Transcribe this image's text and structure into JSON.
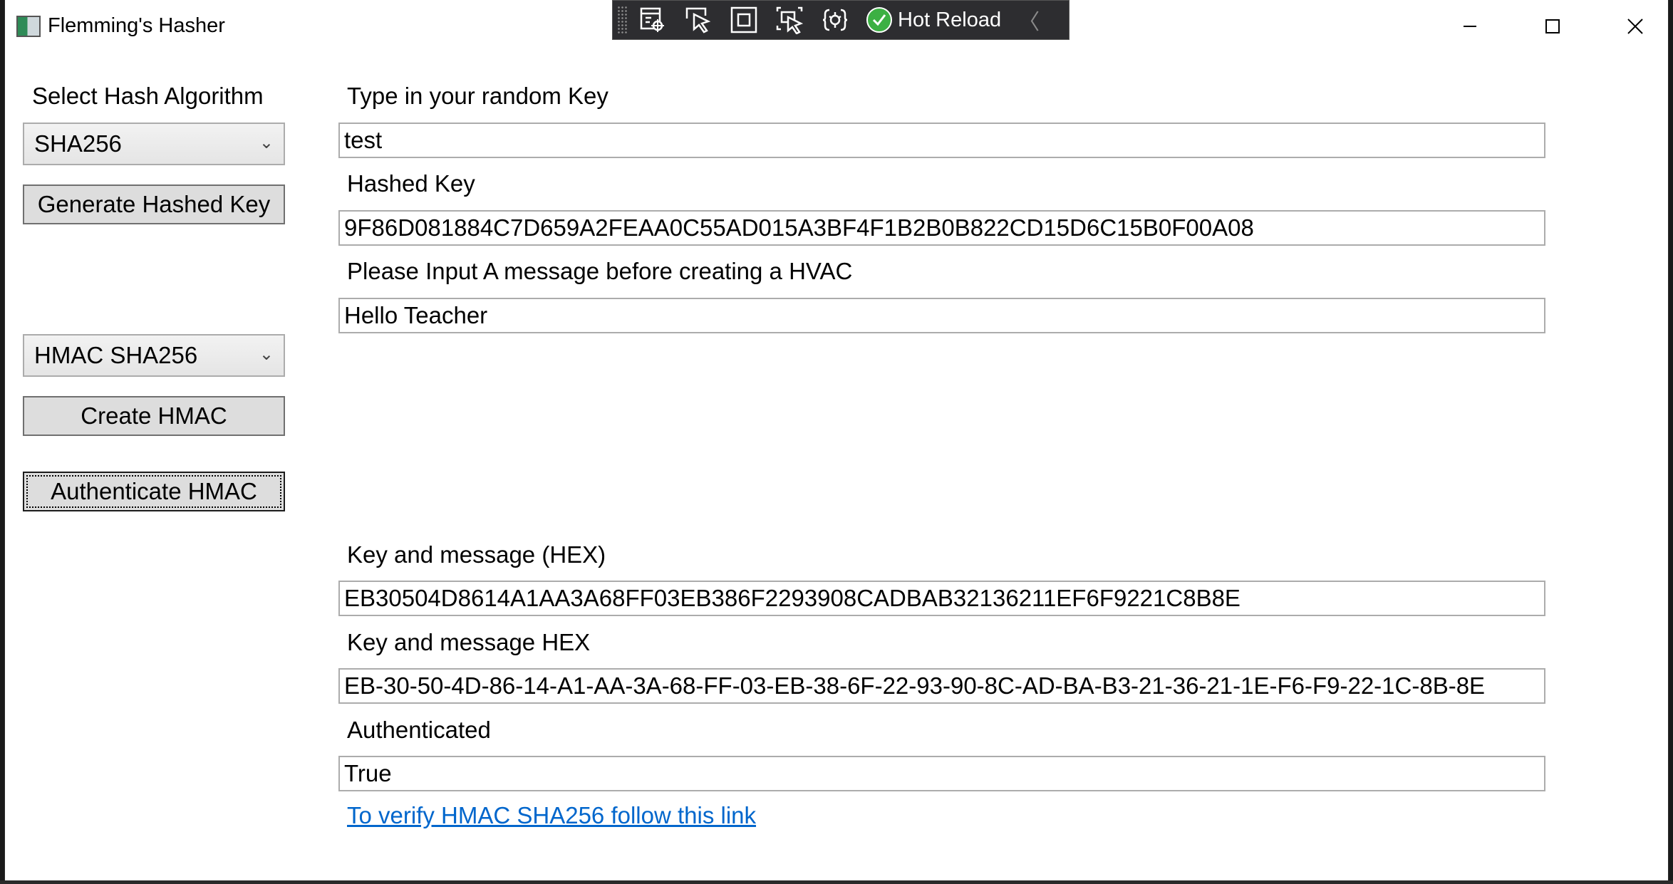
{
  "window": {
    "title": "Flemming's Hasher",
    "minimize_glyph": "—",
    "maximize_glyph": "☐",
    "close_glyph": "✕"
  },
  "devbar": {
    "tools": [
      "live-visual-tree-icon",
      "select-element-icon",
      "display-layout-adorners-icon",
      "track-focus-icon",
      "xaml-binding-icon"
    ],
    "hot_reload_label": "Hot Reload",
    "collapse_glyph": "〈"
  },
  "left": {
    "algorithm_label": "Select Hash Algorithm",
    "algorithm_selected": "SHA256",
    "generate_button": "Generate Hashed Key",
    "hmac_selected": "HMAC SHA256",
    "create_hmac_button": "Create  HMAC",
    "authenticate_button": "Authenticate  HMAC"
  },
  "main": {
    "key_label": "Type in your random Key",
    "key_value": "test",
    "hashed_label": "Hashed Key",
    "hashed_value": "9F86D081884C7D659A2FEAA0C55AD015A3BF4F1B2B0B822CD15D6C15B0F00A08",
    "message_label": "Please Input A message before creating a HVAC",
    "message_value": "Hello Teacher",
    "hex_label": "Key and message (HEX)",
    "hex_value": "EB30504D8614A1AA3A68FF03EB386F2293908CADBAB32136211EF6F9221C8B8E",
    "hex_dash_label": "Key and message HEX",
    "hex_dash_value": "EB-30-50-4D-86-14-A1-AA-3A-68-FF-03-EB-38-6F-22-93-90-8C-AD-BA-B3-21-36-21-1E-F6-F9-22-1C-8B-8E",
    "auth_label": "Authenticated",
    "auth_value": "True",
    "verify_link": "To verify HMAC SHA256 follow this link"
  },
  "colors": {
    "link": "#0066cc",
    "devbar_bg": "#2d2d30",
    "hot_reload_check": "#3cb043"
  }
}
